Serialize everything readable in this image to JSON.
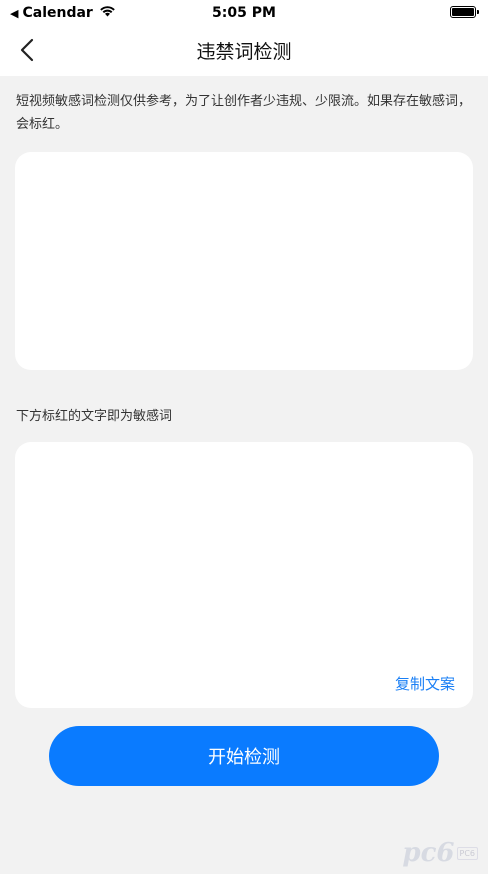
{
  "status_bar": {
    "back_app": "Calendar",
    "time": "5:05 PM"
  },
  "nav": {
    "title": "违禁词检测",
    "back_icon": "chevron-left-icon"
  },
  "intro_text": "短视频敏感词检测仅供参考，为了让创作者少违规、少限流。如果存在敏感词，会标红。",
  "input": {
    "value": "",
    "placeholder": ""
  },
  "result": {
    "label": "下方标红的文字即为敏感词",
    "content": "",
    "copy_label": "复制文案"
  },
  "start_button_label": "开始检测",
  "watermark": {
    "text": "pc6",
    "badge": "PC6"
  },
  "colors": {
    "primary": "#0a7bff",
    "link": "#1a7ff5",
    "background": "#f2f2f2",
    "card": "#ffffff"
  }
}
